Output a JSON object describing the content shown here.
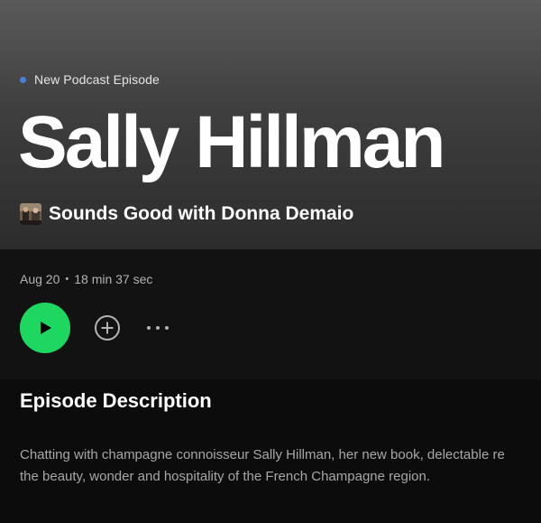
{
  "episode": {
    "badge": "New Podcast Episode",
    "title": "Sally Hillman",
    "show_name": "Sounds Good with Donna Demaio",
    "date": "Aug 20",
    "separator": "•",
    "duration": "18 min 37 sec"
  },
  "description": {
    "heading": "Episode Description",
    "line1": "Chatting with champagne connoisseur Sally Hillman, her new book, delectable re",
    "line2": "the beauty, wonder and hospitality of the French Champagne region."
  },
  "colors": {
    "accent": "#1ed760",
    "badge_dot": "#4c7fd8",
    "header_top": "#5a5a5a",
    "header_bottom": "#2c2c2c",
    "background": "#121212"
  },
  "icons": {
    "play": "play-icon",
    "add": "add-circle-icon",
    "more": "more-horizontal-icon"
  }
}
